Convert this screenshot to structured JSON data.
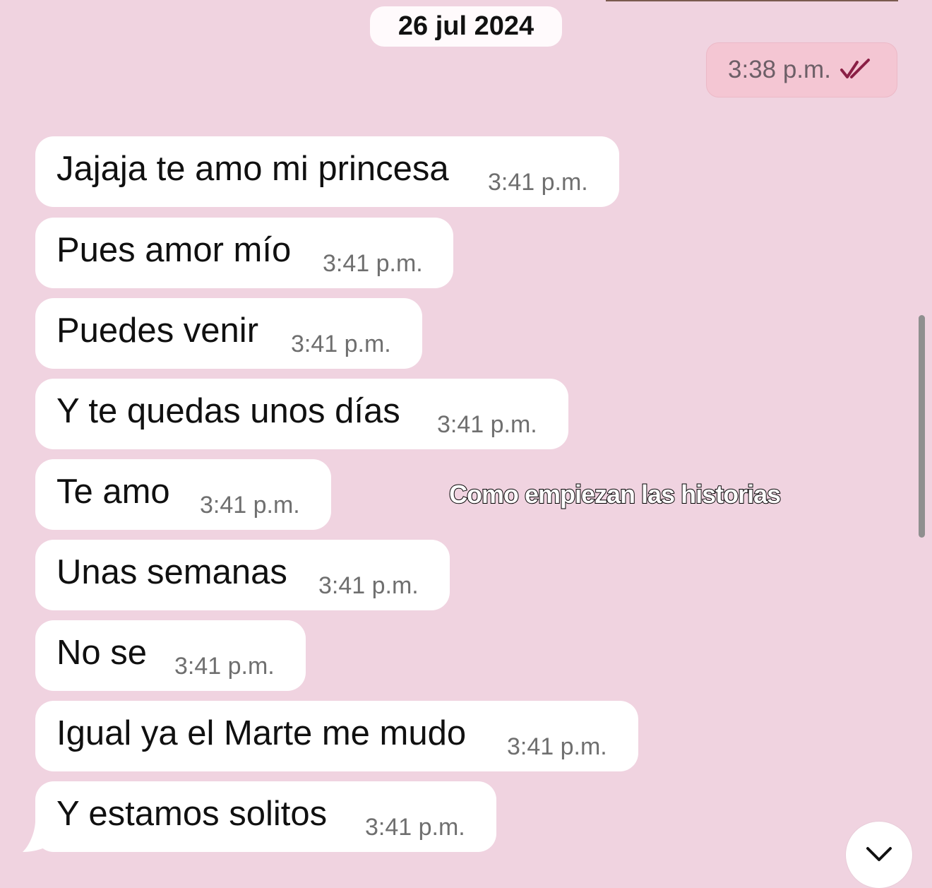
{
  "header": {
    "date_label": "26 jul 2024"
  },
  "sent": {
    "time": "3:38 p.m.",
    "status_icon": "double-check-icon",
    "status_color": "#8a1f45"
  },
  "messages": [
    {
      "text": "Jajaja te amo mi princesa",
      "time": "3:41 p.m."
    },
    {
      "text": "Pues amor mío",
      "time": "3:41 p.m."
    },
    {
      "text": "Puedes venir",
      "time": "3:41 p.m."
    },
    {
      "text": "Y te quedas unos días",
      "time": "3:41 p.m."
    },
    {
      "text": "Te amo",
      "time": "3:41 p.m."
    },
    {
      "text": "Unas semanas",
      "time": "3:41 p.m."
    },
    {
      "text": "No se",
      "time": "3:41 p.m."
    },
    {
      "text": "Igual ya el Marte me mudo",
      "time": "3:41 p.m."
    },
    {
      "text": "Y estamos solitos",
      "time": "3:41 p.m."
    }
  ],
  "overlay": {
    "caption": "Como empiezan las historias"
  },
  "controls": {
    "scroll_down_icon": "chevron-down-icon"
  },
  "colors": {
    "background": "#f0d3e0",
    "incoming_bubble": "#ffffff",
    "sent_bubble": "#f4c6d3"
  }
}
